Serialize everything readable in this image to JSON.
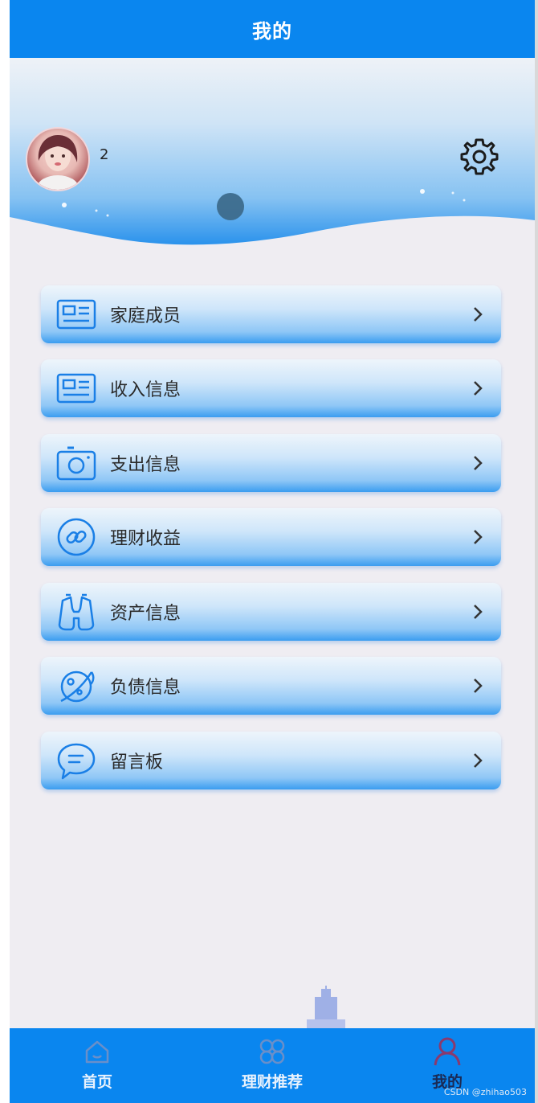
{
  "header": {
    "title": "我的"
  },
  "profile": {
    "username": "2"
  },
  "menu": [
    {
      "label": "家庭成员",
      "icon": "id-card-icon"
    },
    {
      "label": "收入信息",
      "icon": "id-card-icon"
    },
    {
      "label": "支出信息",
      "icon": "camera-icon"
    },
    {
      "label": "理财收益",
      "icon": "link-icon"
    },
    {
      "label": "资产信息",
      "icon": "binoculars-icon"
    },
    {
      "label": "负债信息",
      "icon": "planet-icon"
    },
    {
      "label": "留言板",
      "icon": "chat-bubble-icon"
    }
  ],
  "tabbar": {
    "items": [
      {
        "label": "首页",
        "icon": "home-icon",
        "active": false
      },
      {
        "label": "理财推荐",
        "icon": "grid-icon",
        "active": false
      },
      {
        "label": "我的",
        "icon": "user-icon",
        "active": true
      }
    ]
  },
  "watermark": "CSDN @zhihao503",
  "colors": {
    "primary": "#0a86ef",
    "page_bg": "#efedf2",
    "active_tab_text": "#1a2a55"
  }
}
